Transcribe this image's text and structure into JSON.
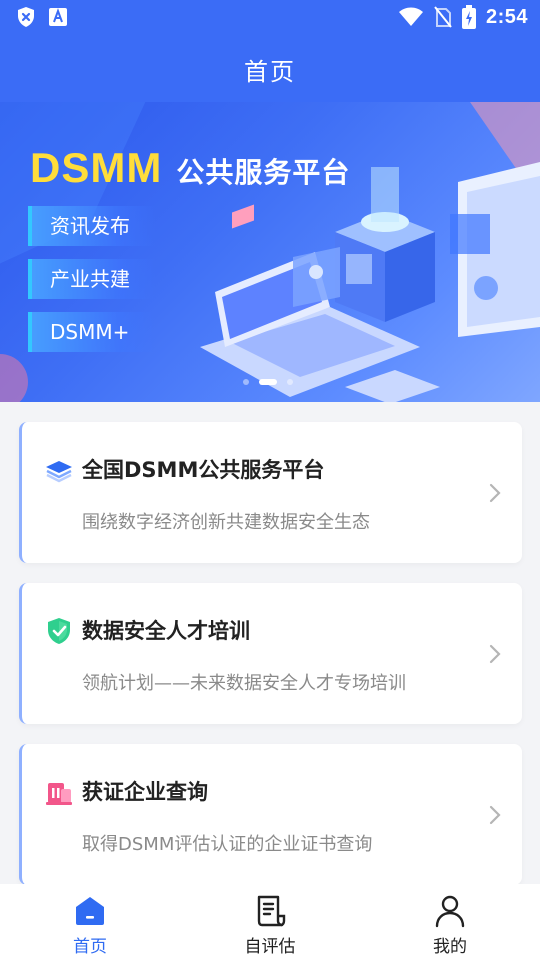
{
  "status_bar": {
    "time": "2:54",
    "left_icons": [
      "shield-x-icon",
      "font-a-icon"
    ],
    "right_icons": [
      "wifi-icon",
      "no-sim-icon",
      "battery-charging-icon"
    ]
  },
  "app_bar": {
    "title": "首页"
  },
  "banner": {
    "brand": "DSMM",
    "subtitle": "公共服务平台",
    "pills": [
      "资讯发布",
      "产业共建",
      "DSMM+"
    ],
    "page_indicator": {
      "total": 3,
      "active": 2
    }
  },
  "cards": [
    {
      "icon": "layers-icon",
      "title": "全国DSMM公共服务平台",
      "desc": "围绕数字经济创新共建数据安全生态"
    },
    {
      "icon": "shield-check-icon",
      "title": "数据安全人才培训",
      "desc": "领航计划——未来数据安全人才专场培训"
    },
    {
      "icon": "building-icon",
      "title": "获证企业查询",
      "desc": "取得DSMM评估认证的企业证书查询"
    }
  ],
  "tabbar": {
    "items": [
      {
        "label": "首页",
        "icon": "home-icon",
        "active": true
      },
      {
        "label": "自评估",
        "icon": "document-icon",
        "active": false
      },
      {
        "label": "我的",
        "icon": "user-icon",
        "active": false
      }
    ]
  },
  "colors": {
    "primary": "#3b6cf6",
    "brand_yellow": "#ffdd3a",
    "active_tab": "#2f6bf2",
    "shield_green": "#2fcf8e",
    "building_pink": "#f2568a"
  }
}
